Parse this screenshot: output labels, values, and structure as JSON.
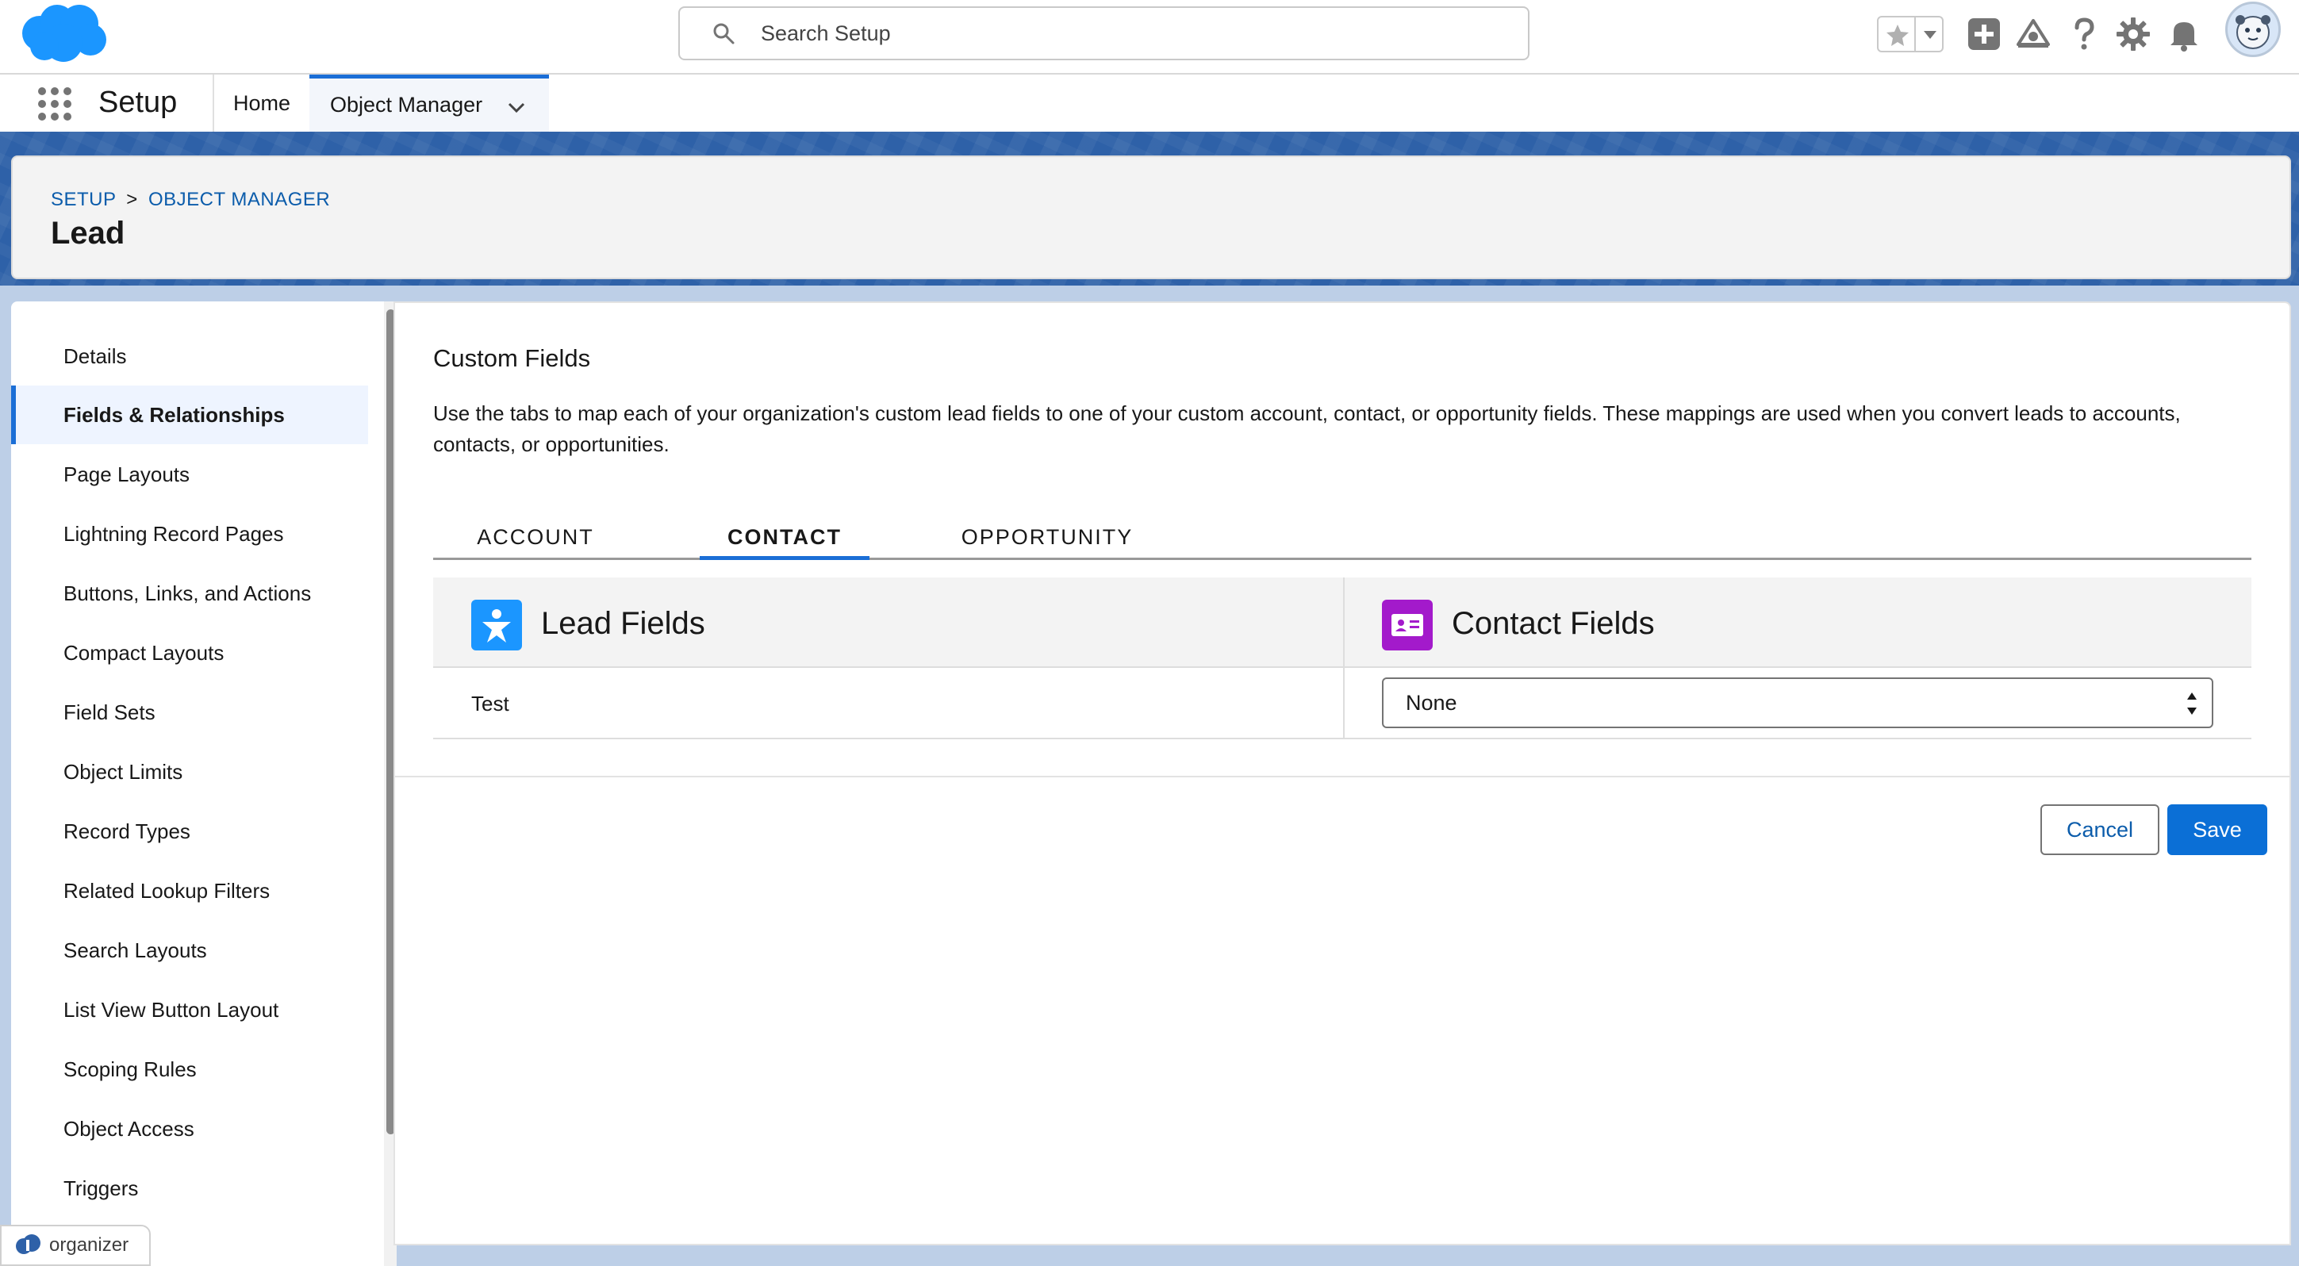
{
  "header": {
    "search_placeholder": "Search Setup"
  },
  "context_bar": {
    "app_name": "Setup",
    "nav": [
      {
        "label": "Home"
      },
      {
        "label": "Object Manager"
      }
    ]
  },
  "page_header": {
    "breadcrumb": [
      "SETUP",
      "OBJECT MANAGER"
    ],
    "breadcrumb_separator": ">",
    "title": "Lead"
  },
  "sidebar": {
    "items": [
      {
        "label": "Details"
      },
      {
        "label": "Fields & Relationships",
        "active": true
      },
      {
        "label": "Page Layouts"
      },
      {
        "label": "Lightning Record Pages"
      },
      {
        "label": "Buttons, Links, and Actions"
      },
      {
        "label": "Compact Layouts"
      },
      {
        "label": "Field Sets"
      },
      {
        "label": "Object Limits"
      },
      {
        "label": "Record Types"
      },
      {
        "label": "Related Lookup Filters"
      },
      {
        "label": "Search Layouts"
      },
      {
        "label": "List View Button Layout"
      },
      {
        "label": "Scoping Rules"
      },
      {
        "label": "Object Access"
      },
      {
        "label": "Triggers"
      }
    ]
  },
  "main": {
    "section_title": "Custom Fields",
    "description": "Use the tabs to map each of your organization's custom lead fields to one of your custom account, contact, or opportunity fields. These mappings are used when you convert leads to accounts, contacts, or opportunities.",
    "tabs": [
      {
        "label": "ACCOUNT"
      },
      {
        "label": "CONTACT",
        "active": true
      },
      {
        "label": "OPPORTUNITY"
      }
    ],
    "mapping": {
      "left_header": "Lead Fields",
      "right_header": "Contact Fields",
      "rows": [
        {
          "field": "Test",
          "mapped_to": "None"
        }
      ]
    },
    "buttons": {
      "cancel": "Cancel",
      "save": "Save"
    }
  },
  "organizer": {
    "label": "organizer"
  },
  "colors": {
    "brand_blue": "#0b6fd6",
    "lead_icon": "#1b96ff",
    "contact_icon": "#a31acb",
    "link": "#0b5cab"
  }
}
